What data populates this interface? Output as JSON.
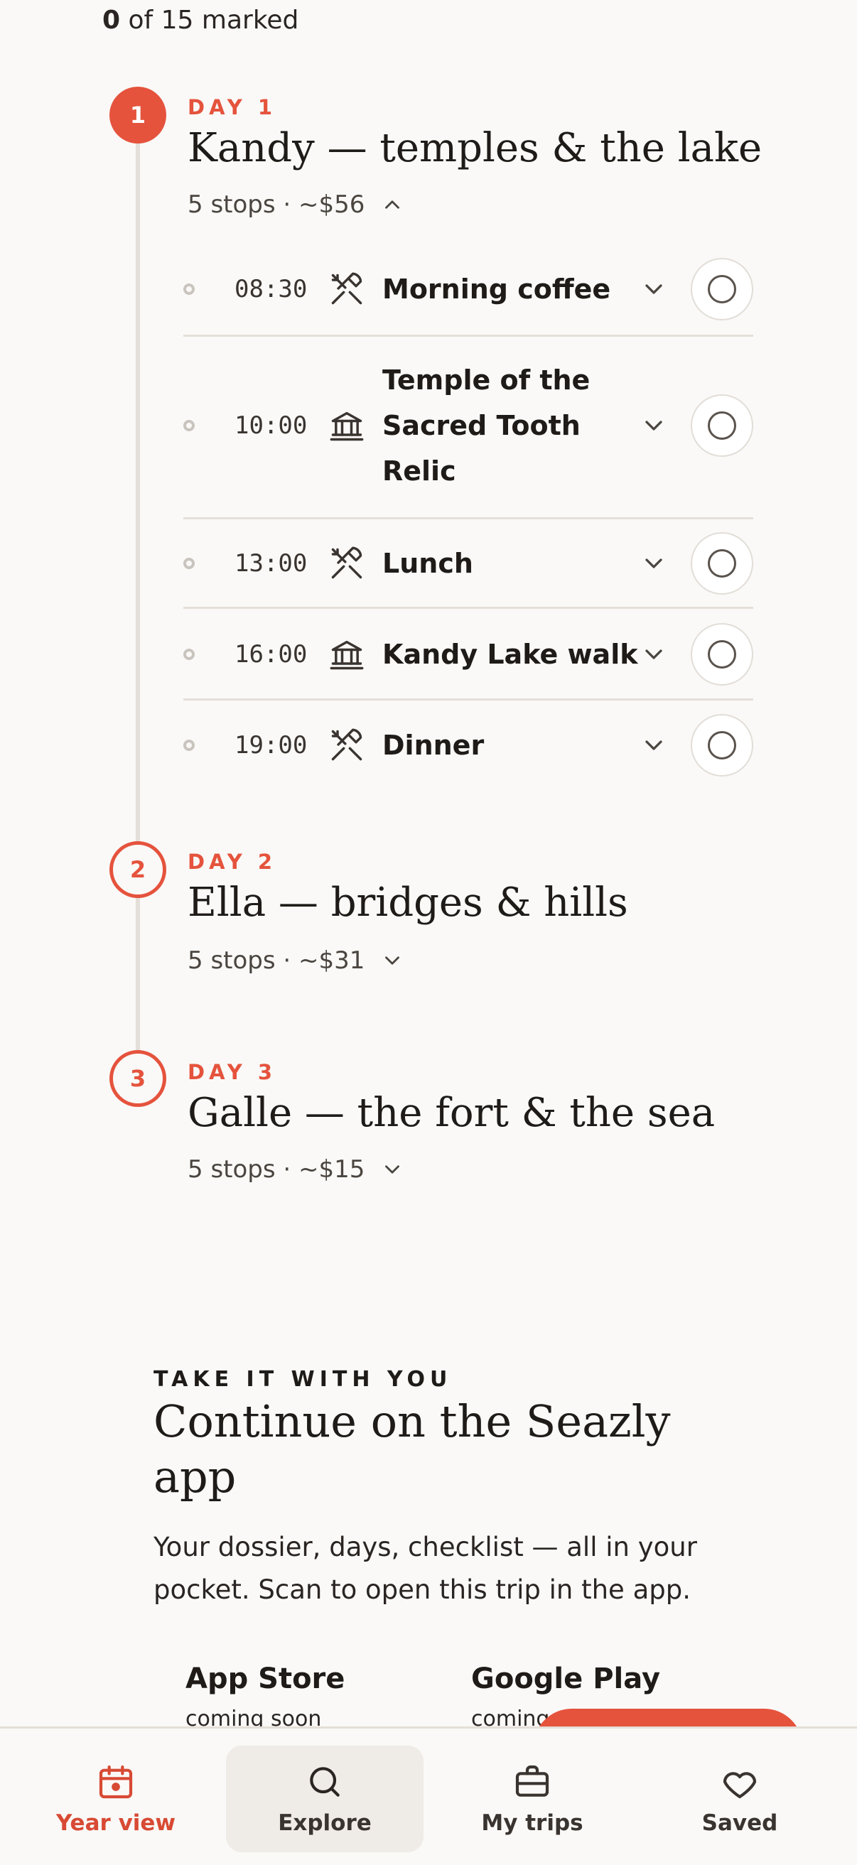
{
  "progress": {
    "count": "0",
    "text": " of 15 marked"
  },
  "days": [
    {
      "number": "1",
      "label": "DAY 1",
      "title": "Kandy — temples & the lake",
      "meta": "5 stops · ~$56",
      "expanded": true,
      "stops": [
        {
          "time": "08:30",
          "icon": "utensils-crossed-icon",
          "name": "Morning coffee"
        },
        {
          "time": "10:00",
          "icon": "landmark-icon",
          "name": "Temple of the Sacred Tooth Relic"
        },
        {
          "time": "13:00",
          "icon": "utensils-crossed-icon",
          "name": "Lunch"
        },
        {
          "time": "16:00",
          "icon": "landmark-icon",
          "name": "Kandy Lake walk"
        },
        {
          "time": "19:00",
          "icon": "utensils-crossed-icon",
          "name": "Dinner"
        }
      ]
    },
    {
      "number": "2",
      "label": "DAY 2",
      "title": "Ella — bridges & hills",
      "meta": "5 stops · ~$31",
      "expanded": false
    },
    {
      "number": "3",
      "label": "DAY 3",
      "title": "Galle — the fort & the sea",
      "meta": "5 stops · ~$15",
      "expanded": false
    }
  ],
  "promo": {
    "eyebrow": "TAKE IT WITH YOU",
    "title": "Continue on the Seazly app",
    "body": "Your dossier, days, checklist — all in your pocket. Scan to open this trip in the app.",
    "stores": [
      {
        "name": "App Store",
        "status": "coming soon"
      },
      {
        "name": "Google Play",
        "status": "coming soon"
      }
    ]
  },
  "tabs": [
    {
      "label": "Year view",
      "icon": "calendar-icon",
      "active": true
    },
    {
      "label": "Explore",
      "icon": "search-icon",
      "highlighted": true
    },
    {
      "label": "My trips",
      "icon": "briefcase-icon"
    },
    {
      "label": "Saved",
      "icon": "heart-icon"
    }
  ],
  "colors": {
    "accent": "#e5533d",
    "background": "#faf9f7",
    "line": "#e4dfd8"
  }
}
